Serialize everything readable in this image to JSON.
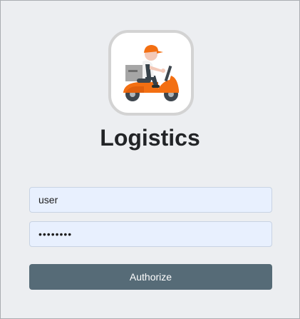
{
  "app": {
    "title": "Logistics",
    "logo_icon": "delivery-scooter-icon"
  },
  "login": {
    "username_value": "user",
    "password_value": "password",
    "submit_label": "Authorize"
  },
  "colors": {
    "background": "#eceef1",
    "input_fill": "#e8f0fe",
    "button": "#566b77",
    "accent": "#f36f12"
  }
}
